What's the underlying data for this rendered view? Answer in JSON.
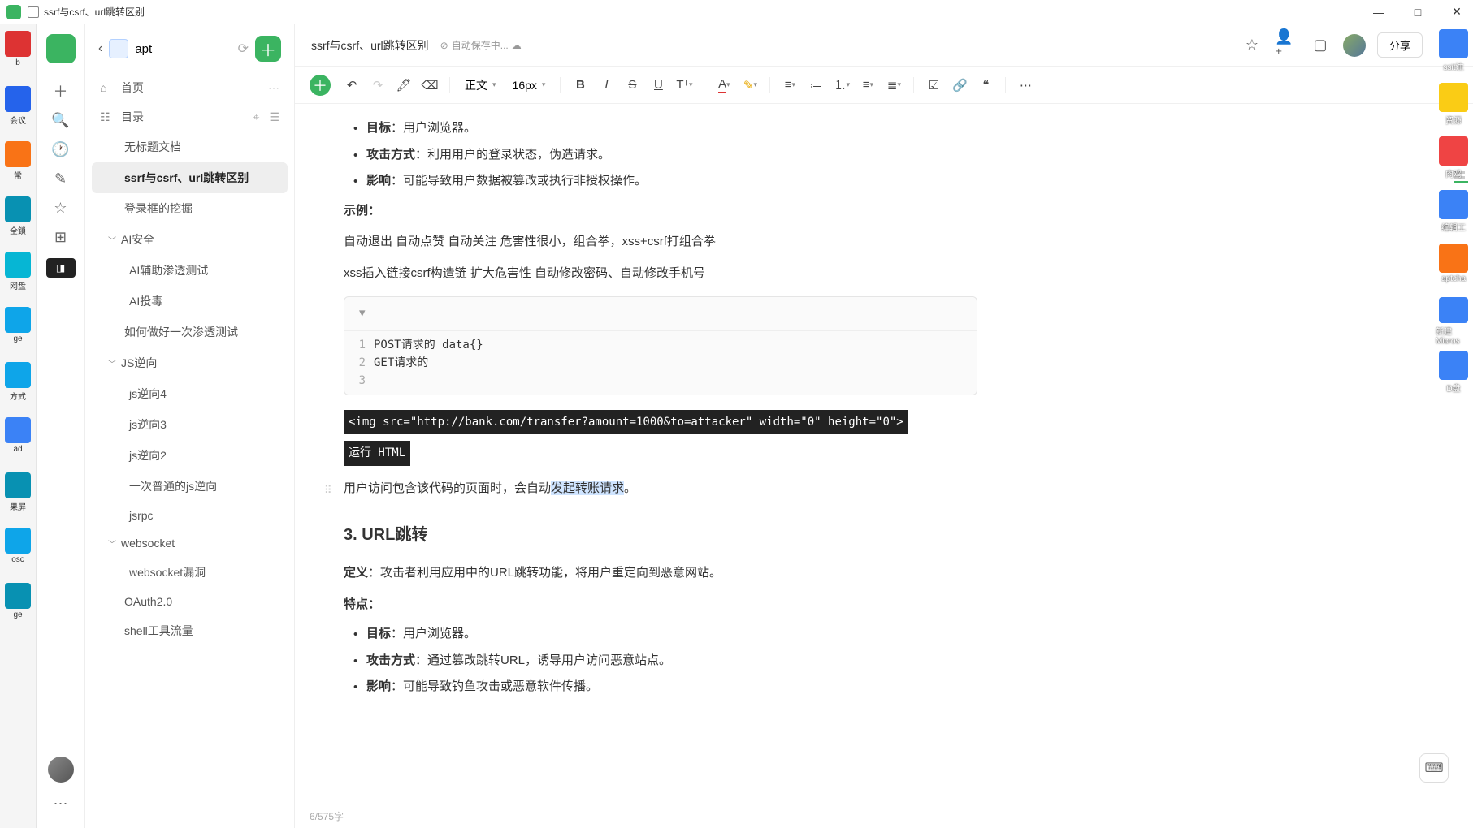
{
  "window": {
    "title": "ssrf与csrf、url跳转区别"
  },
  "win_controls": {
    "min": "—",
    "max": "□",
    "close": "✕"
  },
  "left_desktop": [
    {
      "label": "b",
      "color": "#d33"
    },
    {
      "label": "会议",
      "color": "#2563eb"
    },
    {
      "label": "常",
      "color": "#f97316"
    },
    {
      "label": "全鎖",
      "color": "#0891b2"
    },
    {
      "label": "网盘",
      "color": "#06b6d4"
    },
    {
      "label": "ge",
      "color": "#0ea5e9"
    },
    {
      "label": "方式",
      "color": "#0ea5e9"
    },
    {
      "label": "ad",
      "color": "#3b82f6"
    },
    {
      "label": "果屏",
      "color": "#0891b2"
    },
    {
      "label": "osc",
      "color": "#0ea5e9"
    },
    {
      "label": "ge",
      "color": "#0891b2"
    }
  ],
  "right_desktop": [
    {
      "label": "ssit注",
      "color": "#3b82f6"
    },
    {
      "label": "资源",
      "color": "#facc15"
    },
    {
      "label": "肉鸡",
      "color": "#ef4444"
    },
    {
      "label": "编辑工",
      "color": "#3b82f6"
    },
    {
      "label": "aptcha",
      "color": "#f97316"
    },
    {
      "label": "新建\nMicros",
      "color": "#3b82f6"
    },
    {
      "label": "D盘",
      "color": "#3b82f6"
    }
  ],
  "rail": {
    "icons": [
      "＋",
      "🔍",
      "🕐",
      "✎",
      "☆",
      "⊞"
    ],
    "split": "◨",
    "more": "⋯"
  },
  "sidebar": {
    "back": "‹",
    "space_name": "apt",
    "sync_icon": "⟳",
    "add": "＋",
    "home": "首页",
    "toc_label": "目录",
    "toc_icons": {
      "locate": "⌖",
      "list": "☰"
    },
    "tree": [
      {
        "type": "item",
        "label": "无标题文档"
      },
      {
        "type": "item",
        "label": "ssrf与csrf、url跳转区别",
        "active": true
      },
      {
        "type": "item",
        "label": "登录框的挖掘"
      },
      {
        "type": "group",
        "label": "AI安全",
        "children": [
          "AI辅助渗透测试",
          "AI投毒"
        ]
      },
      {
        "type": "item",
        "label": "如何做好一次渗透测试"
      },
      {
        "type": "group",
        "label": "JS逆向",
        "children": [
          "js逆向4",
          "js逆向3",
          "js逆向2",
          "一次普通的js逆向",
          "jsrpc"
        ]
      },
      {
        "type": "group",
        "label": "websocket",
        "children": [
          "websocket漏洞"
        ]
      },
      {
        "type": "item",
        "label": "OAuth2.0"
      },
      {
        "type": "item",
        "label": "shell工具流量"
      }
    ]
  },
  "doc_header": {
    "title": "ssrf与csrf、url跳转区别",
    "status_icon": "⊘",
    "status_text": "自动保存中...",
    "cloud": "☁",
    "share": "分享"
  },
  "toolbar": {
    "undo": "↶",
    "redo": "↷",
    "brush": "🖊",
    "eraser": "⌫",
    "para_style": "正文",
    "font_size": "16px",
    "bold": "B",
    "italic": "I",
    "strike": "S",
    "underline": "U",
    "format_t": "Tᵀ",
    "color": "A",
    "highlight": "✎",
    "align": "≡",
    "ul": "•☰",
    "ol": "1☰",
    "indent_out": "⇤",
    "indent_in": "⇥",
    "task": "☑",
    "link": "🔗",
    "quote": "❝",
    "more": "⋯"
  },
  "content": {
    "bullets1": [
      {
        "k": "目标",
        "v": "：用户浏览器。"
      },
      {
        "k": "攻击方式",
        "v": "：利用用户的登录状态，伪造请求。"
      },
      {
        "k": "影响",
        "v": "：可能导致用户数据被篡改或执行非授权操作。"
      }
    ],
    "example_label": "示例：",
    "p1": "自动退出  自动点赞  自动关注 危害性很小，组合拳，xss+csrf打组合拳",
    "p2": "xss插入链接csrf构造链  扩大危害性    自动修改密码、自动修改手机号",
    "code": {
      "chev": "▾",
      "lines": [
        "POST请求的    data{}",
        "GET请求的",
        ""
      ]
    },
    "black1": "<img src=\"http://bank.com/transfer?amount=1000&to=attacker\" width=\"0\" height=\"0\">",
    "black2": "运行 HTML",
    "p3_pre": "用户访问包含该代码的页面时，会自动",
    "p3_hl": "发起转账请求",
    "p3_post": "。",
    "h3": "3. URL跳转",
    "def_k": "定义",
    "def_v": "：攻击者利用应用中的URL跳转功能，将用户重定向到恶意网站。",
    "feat_label": "特点：",
    "bullets2": [
      {
        "k": "目标",
        "v": "：用户浏览器。"
      },
      {
        "k": "攻击方式",
        "v": "：通过篡改跳转URL，诱导用户访问恶意站点。"
      },
      {
        "k": "影响",
        "v": "：可能导致钓鱼攻击或恶意软件传播。"
      }
    ]
  },
  "footer": {
    "count": "6/575字"
  },
  "kbd_icon": "⌨"
}
